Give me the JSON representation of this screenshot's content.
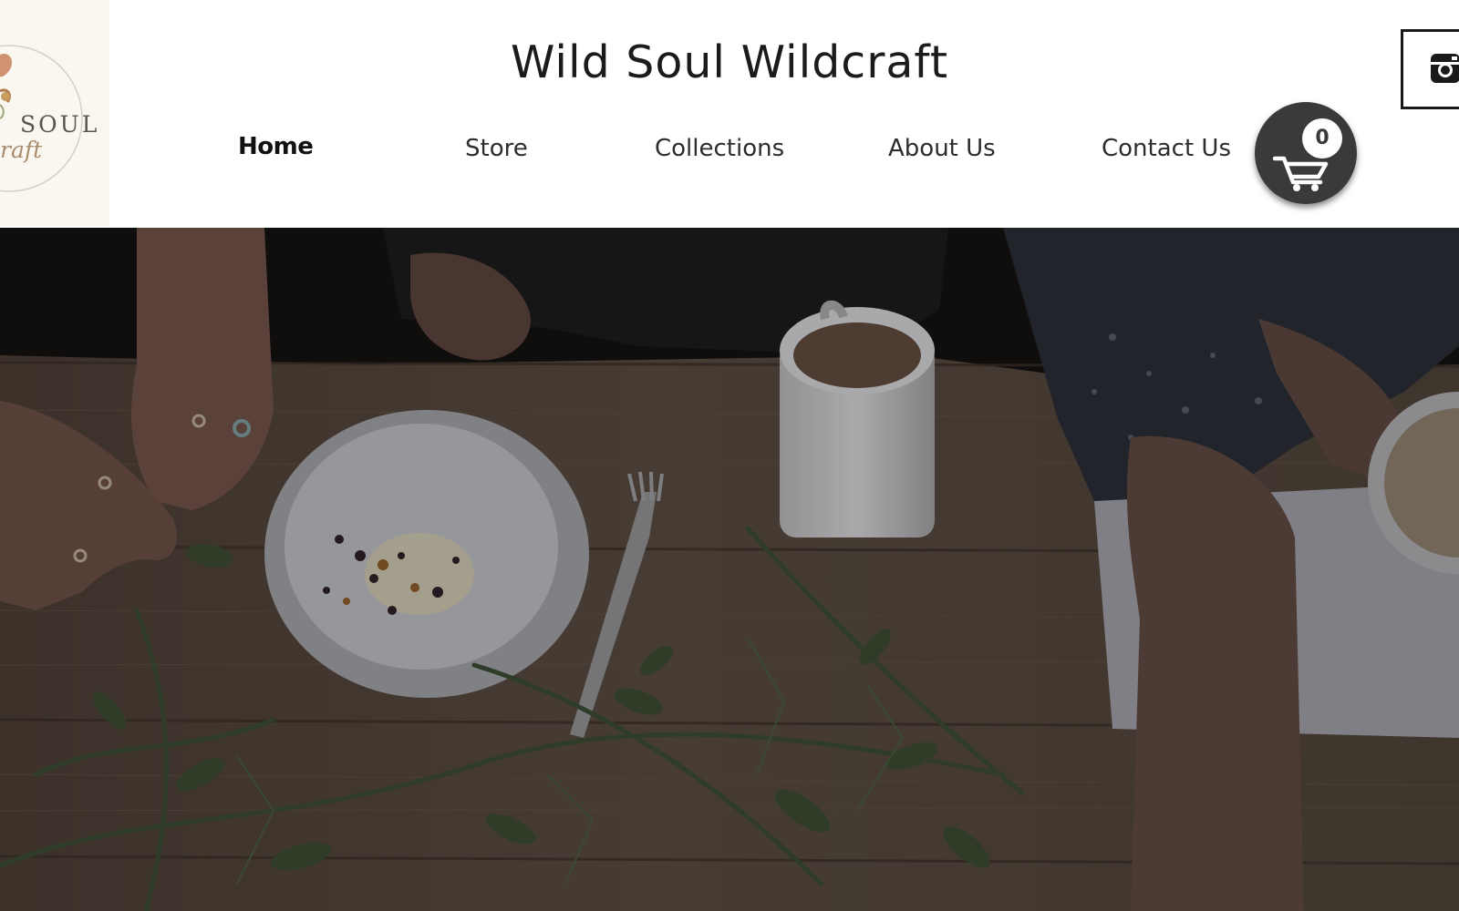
{
  "site": {
    "title": "Wild Soul Wildcraft",
    "logo_word": "SOUL",
    "logo_script": "raft"
  },
  "nav": {
    "items": [
      {
        "label": "Home",
        "active": true
      },
      {
        "label": "Store"
      },
      {
        "label": "Collections"
      },
      {
        "label": "About Us"
      },
      {
        "label": "Contact Us"
      }
    ]
  },
  "cart": {
    "count": "0",
    "icon": "shopping-cart-icon"
  },
  "social": {
    "icon": "instagram-icon"
  },
  "hero": {
    "image": "herbs-on-wooden-table-photo"
  },
  "colors": {
    "header_bg": "#ffffff",
    "cart_bg": "#3a3a3a",
    "text": "#1b1b1b",
    "logo_bg": "#faf6f0"
  }
}
